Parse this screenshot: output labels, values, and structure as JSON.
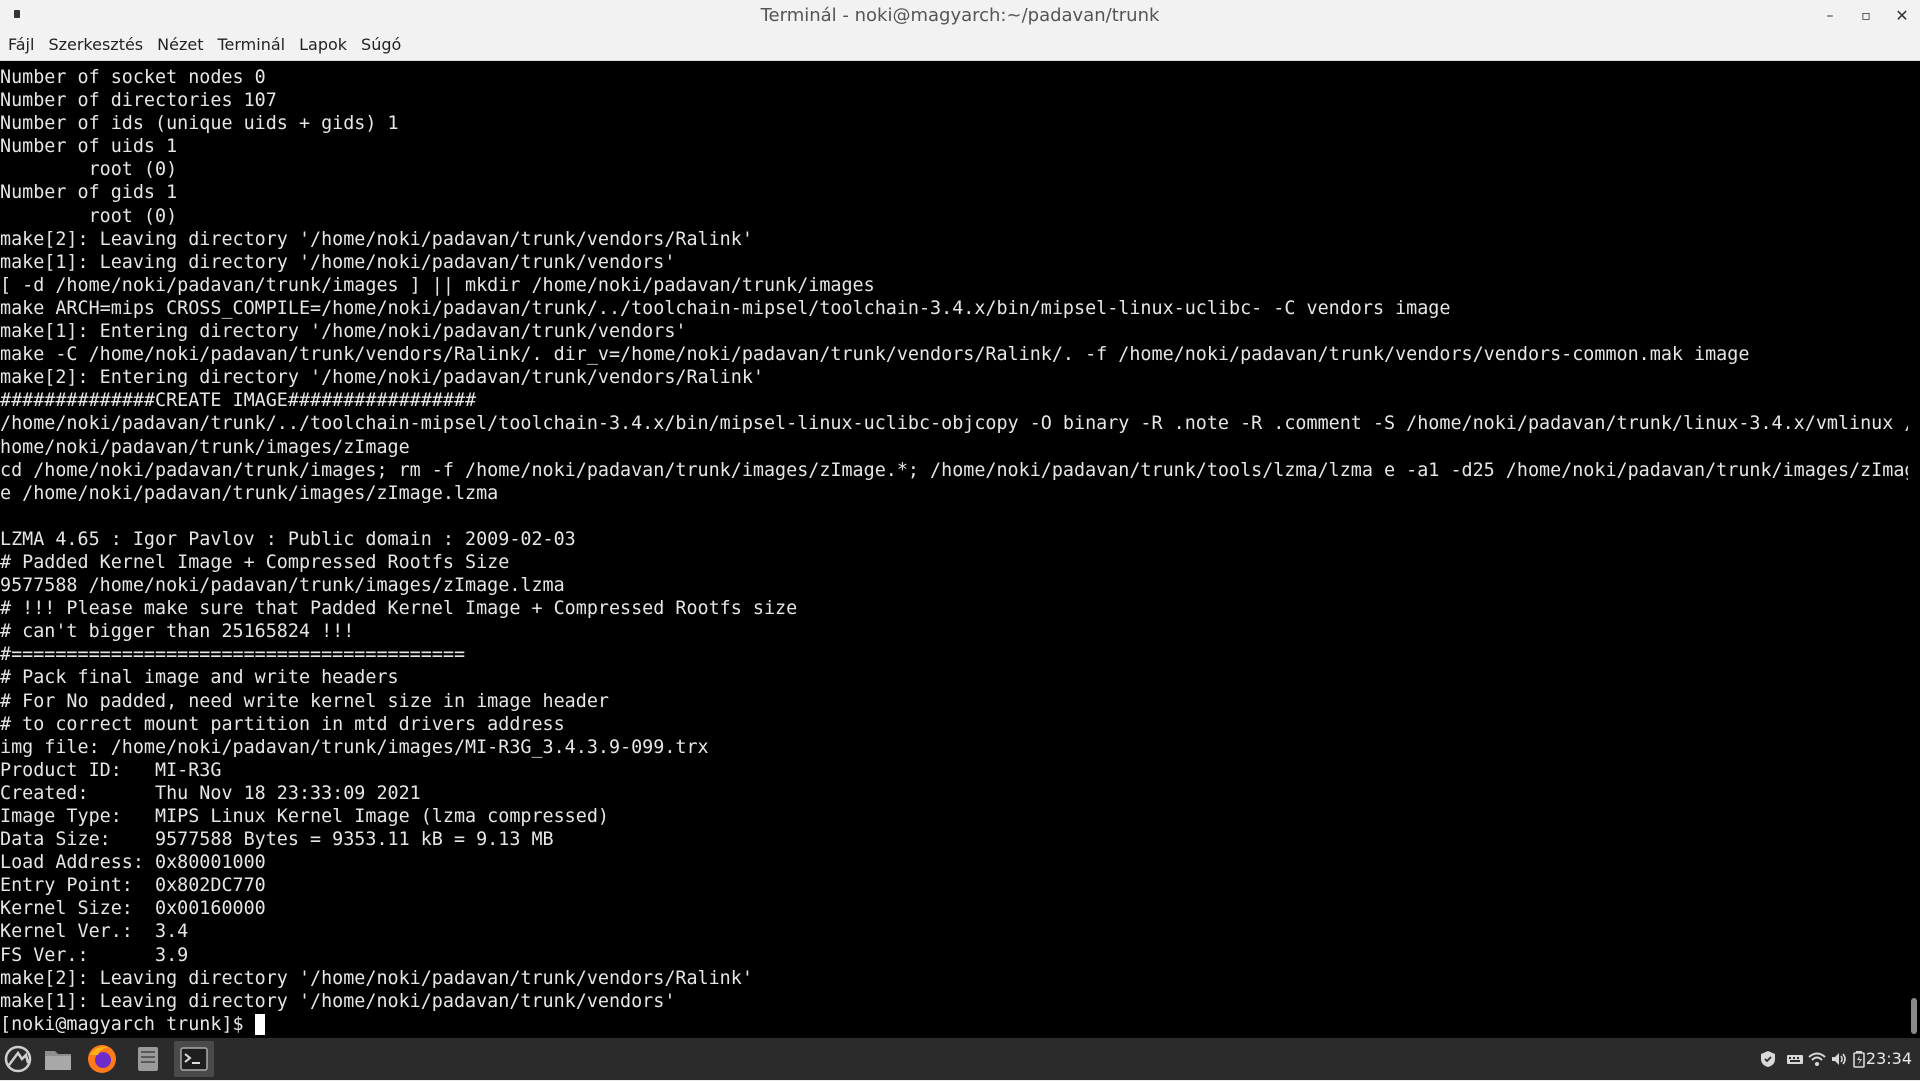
{
  "window": {
    "title": "Terminál - noki@magyarch:~/padavan/trunk",
    "controls": {
      "minimize": "–",
      "maximize": "▫",
      "close": "✕"
    }
  },
  "menubar": [
    "Fájl",
    "Szerkesztés",
    "Nézet",
    "Terminál",
    "Lapok",
    "Súgó"
  ],
  "terminal": {
    "lines": [
      "Number of socket nodes 0",
      "Number of directories 107",
      "Number of ids (unique uids + gids) 1",
      "Number of uids 1",
      "        root (0)",
      "Number of gids 1",
      "        root (0)",
      "make[2]: Leaving directory '/home/noki/padavan/trunk/vendors/Ralink'",
      "make[1]: Leaving directory '/home/noki/padavan/trunk/vendors'",
      "[ -d /home/noki/padavan/trunk/images ] || mkdir /home/noki/padavan/trunk/images",
      "make ARCH=mips CROSS_COMPILE=/home/noki/padavan/trunk/../toolchain-mipsel/toolchain-3.4.x/bin/mipsel-linux-uclibc- -C vendors image",
      "make[1]: Entering directory '/home/noki/padavan/trunk/vendors'",
      "make -C /home/noki/padavan/trunk/vendors/Ralink/. dir_v=/home/noki/padavan/trunk/vendors/Ralink/. -f /home/noki/padavan/trunk/vendors/vendors-common.mak image",
      "make[2]: Entering directory '/home/noki/padavan/trunk/vendors/Ralink'",
      "##############CREATE IMAGE#################",
      "/home/noki/padavan/trunk/../toolchain-mipsel/toolchain-3.4.x/bin/mipsel-linux-uclibc-objcopy -O binary -R .note -R .comment -S /home/noki/padavan/trunk/linux-3.4.x/vmlinux /",
      "home/noki/padavan/trunk/images/zImage",
      "cd /home/noki/padavan/trunk/images; rm -f /home/noki/padavan/trunk/images/zImage.*; /home/noki/padavan/trunk/tools/lzma/lzma e -a1 -d25 /home/noki/padavan/trunk/images/zImag",
      "e /home/noki/padavan/trunk/images/zImage.lzma",
      "",
      "LZMA 4.65 : Igor Pavlov : Public domain : 2009-02-03",
      "# Padded Kernel Image + Compressed Rootfs Size",
      "9577588 /home/noki/padavan/trunk/images/zImage.lzma",
      "# !!! Please make sure that Padded Kernel Image + Compressed Rootfs size",
      "# can't bigger than 25165824 !!!",
      "#=========================================",
      "# Pack final image and write headers",
      "# For No padded, need write kernel size in image header",
      "# to correct mount partition in mtd drivers address",
      "img file: /home/noki/padavan/trunk/images/MI-R3G_3.4.3.9-099.trx",
      "Product ID:   MI-R3G",
      "Created:      Thu Nov 18 23:33:09 2021",
      "Image Type:   MIPS Linux Kernel Image (lzma compressed)",
      "Data Size:    9577588 Bytes = 9353.11 kB = 9.13 MB",
      "Load Address: 0x80001000",
      "Entry Point:  0x802DC770",
      "Kernel Size:  0x00160000",
      "Kernel Ver.:  3.4",
      "FS Ver.:      3.9",
      "make[2]: Leaving directory '/home/noki/padavan/trunk/vendors/Ralink'",
      "make[1]: Leaving directory '/home/noki/padavan/trunk/vendors'"
    ],
    "prompt": "[noki@magyarch trunk]$ "
  },
  "taskbar": {
    "apps": [
      "start-menu-icon",
      "file-manager-icon",
      "firefox-icon",
      "text-editor-icon",
      "terminal-icon"
    ],
    "tray": [
      "shield-icon",
      "keyboard-icon",
      "wifi-icon",
      "volume-icon",
      "battery-icon"
    ],
    "clock": "23:34"
  },
  "colors": {
    "terminal_bg": "#000000",
    "terminal_fg": "#e6e6e6",
    "titlebar_bg": "#f2f2f2",
    "taskbar_bg": "#2b2b2b"
  }
}
